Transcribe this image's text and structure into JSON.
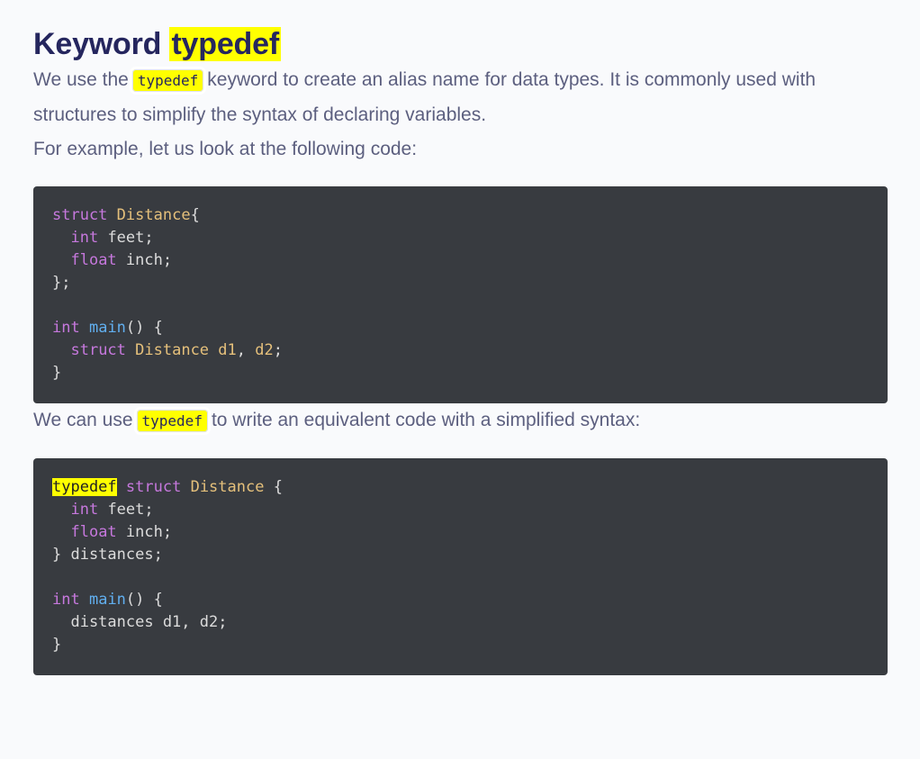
{
  "heading": {
    "prefix": "Keyword ",
    "highlight": "typedef"
  },
  "intro": {
    "before": "We use the",
    "code": "typedef",
    "after": "keyword to create an alias name for data types. It is commonly used with structures to simplify the syntax of declaring variables."
  },
  "example_intro": "For example, let us look at the following code:",
  "code1": {
    "l1_kw": "struct",
    "l1_ty": "Distance",
    "l1_rest": "{",
    "l2_kw": "int",
    "l2_rest": " feet;",
    "l3_kw": "float",
    "l3_rest": " inch;",
    "l4": "};",
    "l6_kw": "int",
    "l6_fn": "main",
    "l6_rest": "() {",
    "l7_kw": "struct",
    "l7_ty": "Distance d1",
    "l7_comma": ",",
    "l7_ty2": " d2",
    "l7_semi": ";",
    "l8": "}"
  },
  "second_intro": {
    "before": "We can use",
    "code": "typedef",
    "after": "to write an equivalent code with a simplified syntax:"
  },
  "code2": {
    "l1_hl": "typedef",
    "l1_kw": "struct",
    "l1_ty": "Distance",
    "l1_rest": " {",
    "l2_kw": "int",
    "l2_rest": " feet;",
    "l3_kw": "float",
    "l3_rest": " inch;",
    "l4": "} distances;",
    "l6_kw": "int",
    "l6_fn": "main",
    "l6_rest": "() {",
    "l7": "  distances d1, d2;",
    "l8": "}"
  },
  "colors": {
    "heading": "#25265e",
    "body_text": "#5c5f7f",
    "highlight": "#ffff00",
    "code_background": "#383b40",
    "code_keyword": "#c678dd",
    "code_type": "#e5c07b",
    "code_function": "#61afef",
    "code_plain": "#dcdcdc"
  }
}
